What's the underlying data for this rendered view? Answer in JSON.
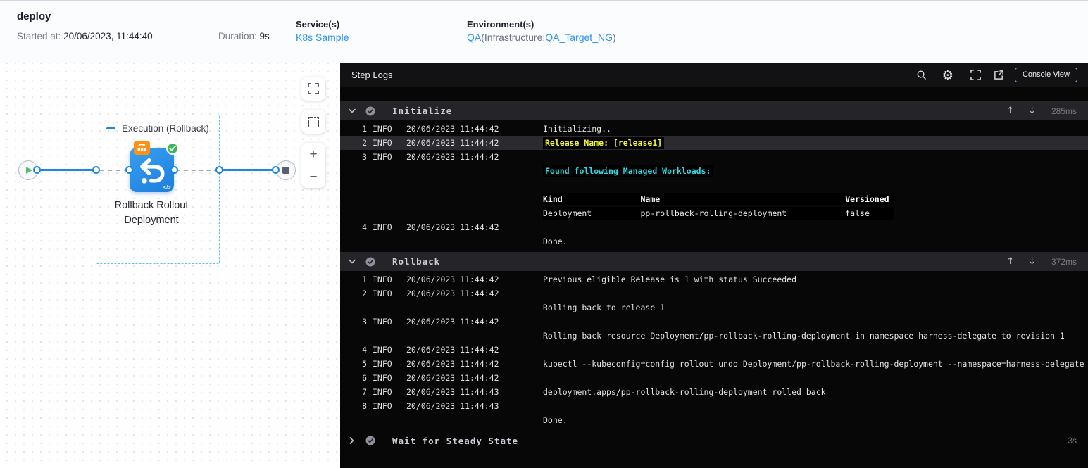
{
  "header": {
    "title": "deploy",
    "started_label": "Started at:",
    "started_value": "20/06/2023, 11:44:40",
    "duration_label": "Duration:",
    "duration_value": "9s",
    "services_label": "Service(s)",
    "service_link": "K8s Sample",
    "environments_label": "Environment(s)",
    "env_link": "QA",
    "env_infra_prefix": "(Infrastructure:",
    "env_infra_link": "QA_Target_NG",
    "env_suffix": ")"
  },
  "graph": {
    "stage_label": "Execution (Rollback)",
    "node_label": "Rollback Rollout Deployment",
    "controls": {
      "zoom_in": "+",
      "zoom_out": "−"
    }
  },
  "logs": {
    "title": "Step Logs",
    "console_view_label": "Console View",
    "sections": [
      {
        "label": "Initialize",
        "duration": "285ms",
        "expanded": true,
        "rows": [
          {
            "num": "1",
            "level": "INFO",
            "time": "20/06/2023 11:44:42",
            "segments": [
              {
                "style": "p",
                "text": "Initializing.."
              }
            ]
          },
          {
            "num": "2",
            "level": "INFO",
            "time": "20/06/2023 11:44:42",
            "highlight": true,
            "segments": [
              {
                "style": "y",
                "text": "Release Name: [release1]"
              }
            ]
          },
          {
            "num": "3",
            "level": "INFO",
            "time": "20/06/2023 11:44:42",
            "segments": []
          },
          {
            "segments": [
              {
                "style": "c",
                "text": "Found following Managed Workloads:"
              }
            ]
          },
          {
            "segments": []
          },
          {
            "segments": [
              {
                "style": "th",
                "text": "Kind                Name                                      Versioned "
              }
            ]
          },
          {
            "segments": [
              {
                "style": "td",
                "text": "Deployment          pp-rollback-rolling-deployment            false     "
              }
            ]
          },
          {
            "num": "4",
            "level": "INFO",
            "time": "20/06/2023 11:44:42",
            "segments": []
          },
          {
            "segments": [
              {
                "style": "p",
                "text": "Done."
              }
            ]
          }
        ]
      },
      {
        "label": "Rollback",
        "duration": "372ms",
        "expanded": true,
        "rows": [
          {
            "num": "1",
            "level": "INFO",
            "time": "20/06/2023 11:44:42",
            "segments": [
              {
                "style": "p",
                "text": "Previous eligible Release is 1 with status Succeeded"
              }
            ]
          },
          {
            "num": "2",
            "level": "INFO",
            "time": "20/06/2023 11:44:42",
            "segments": []
          },
          {
            "segments": [
              {
                "style": "p",
                "text": "Rolling back to release 1"
              }
            ]
          },
          {
            "num": "3",
            "level": "INFO",
            "time": "20/06/2023 11:44:42",
            "segments": []
          },
          {
            "segments": [
              {
                "style": "p",
                "text": "Rolling back resource Deployment/pp-rollback-rolling-deployment in namespace harness-delegate to revision 1"
              }
            ]
          },
          {
            "num": "4",
            "level": "INFO",
            "time": "20/06/2023 11:44:42",
            "segments": []
          },
          {
            "num": "5",
            "level": "INFO",
            "time": "20/06/2023 11:44:42",
            "segments": [
              {
                "style": "p",
                "text": "kubectl --kubeconfig=config rollout undo Deployment/pp-rollback-rolling-deployment --namespace=harness-delegate"
              }
            ]
          },
          {
            "num": "6",
            "level": "INFO",
            "time": "20/06/2023 11:44:42",
            "segments": []
          },
          {
            "num": "7",
            "level": "INFO",
            "time": "20/06/2023 11:44:43",
            "segments": [
              {
                "style": "p",
                "text": "deployment.apps/pp-rollback-rolling-deployment rolled back"
              }
            ]
          },
          {
            "num": "8",
            "level": "INFO",
            "time": "20/06/2023 11:44:43",
            "segments": []
          },
          {
            "segments": [
              {
                "style": "p",
                "text": "Done."
              }
            ]
          }
        ]
      },
      {
        "label": "Wait for Steady State",
        "duration": "3s",
        "expanded": false,
        "rows": []
      }
    ]
  },
  "colors": {
    "accent_blue": "#1b87e0",
    "link_blue": "#2b94ee",
    "node_blue": "#2a90ea",
    "badge_orange": "#ff9013",
    "success_green": "#3bb956",
    "terminal_yellow": "#f6f63c",
    "terminal_cyan": "#30d8e2",
    "panel_bg": "#070708",
    "section_header_bg": "#242429"
  }
}
